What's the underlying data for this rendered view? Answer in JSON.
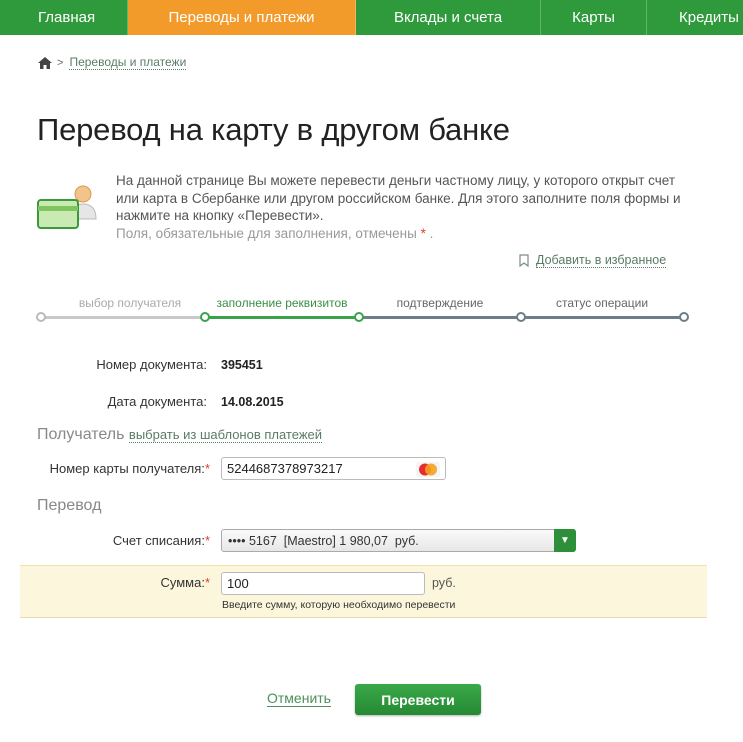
{
  "nav": {
    "items": [
      {
        "label": "Главная"
      },
      {
        "label": "Переводы и платежи",
        "active": true
      },
      {
        "label": "Вклады и счета"
      },
      {
        "label": "Карты"
      },
      {
        "label": "Кредиты"
      }
    ]
  },
  "breadcrumb": {
    "home_icon": "home-icon",
    "separator": ">",
    "item": "Переводы и платежи"
  },
  "page": {
    "title": "Перевод на карту в другом банке",
    "info_icon": "card-person-icon",
    "info_text": "На данной странице Вы можете перевести деньги частному лицу, у которого открыт счет или карта в Сбербанке или другом российском банке. Для этого заполните поля формы и нажмите на кнопку «Перевести».",
    "required_note": "Поля, обязательные для заполнения, отмечены",
    "required_star": "*",
    "required_end": "."
  },
  "favorites": {
    "icon": "bookmark-icon",
    "label": "Добавить в избранное"
  },
  "steps": [
    {
      "label": "выбор получателя",
      "state": "done"
    },
    {
      "label": "заполнение реквизитов",
      "state": "current"
    },
    {
      "label": "подтверждение",
      "state": "pending"
    },
    {
      "label": "статус операции",
      "state": "pending"
    }
  ],
  "document": {
    "number_label": "Номер документа:",
    "number_value": "395451",
    "date_label": "Дата документа:",
    "date_value": "14.08.2015"
  },
  "recipient": {
    "section_title": "Получатель",
    "template_link": "выбрать из шаблонов платежей",
    "card_label": "Номер карты получателя:",
    "required_star": "*",
    "card_value": "5244687378973217",
    "card_brand_icon": "mastercard-icon"
  },
  "transfer": {
    "section_title": "Перевод",
    "account_label": "Счет списания:",
    "required_star": "*",
    "account_value": "•••• 5167  [Maestro] 1 980,07  руб.",
    "amount_label": "Сумма:",
    "amount_value": "100",
    "currency": "руб.",
    "amount_hint": "Введите сумму, которую необходимо перевести"
  },
  "actions": {
    "cancel": "Отменить",
    "submit": "Перевести"
  },
  "colors": {
    "nav_green": "#2f9a3c",
    "nav_active": "#f39b2a",
    "step_done": "#c8c8c8",
    "step_current": "#3aa34a",
    "step_pending": "#6c7f88",
    "sum_band": "#fcf7dc",
    "required": "#e2402a"
  }
}
